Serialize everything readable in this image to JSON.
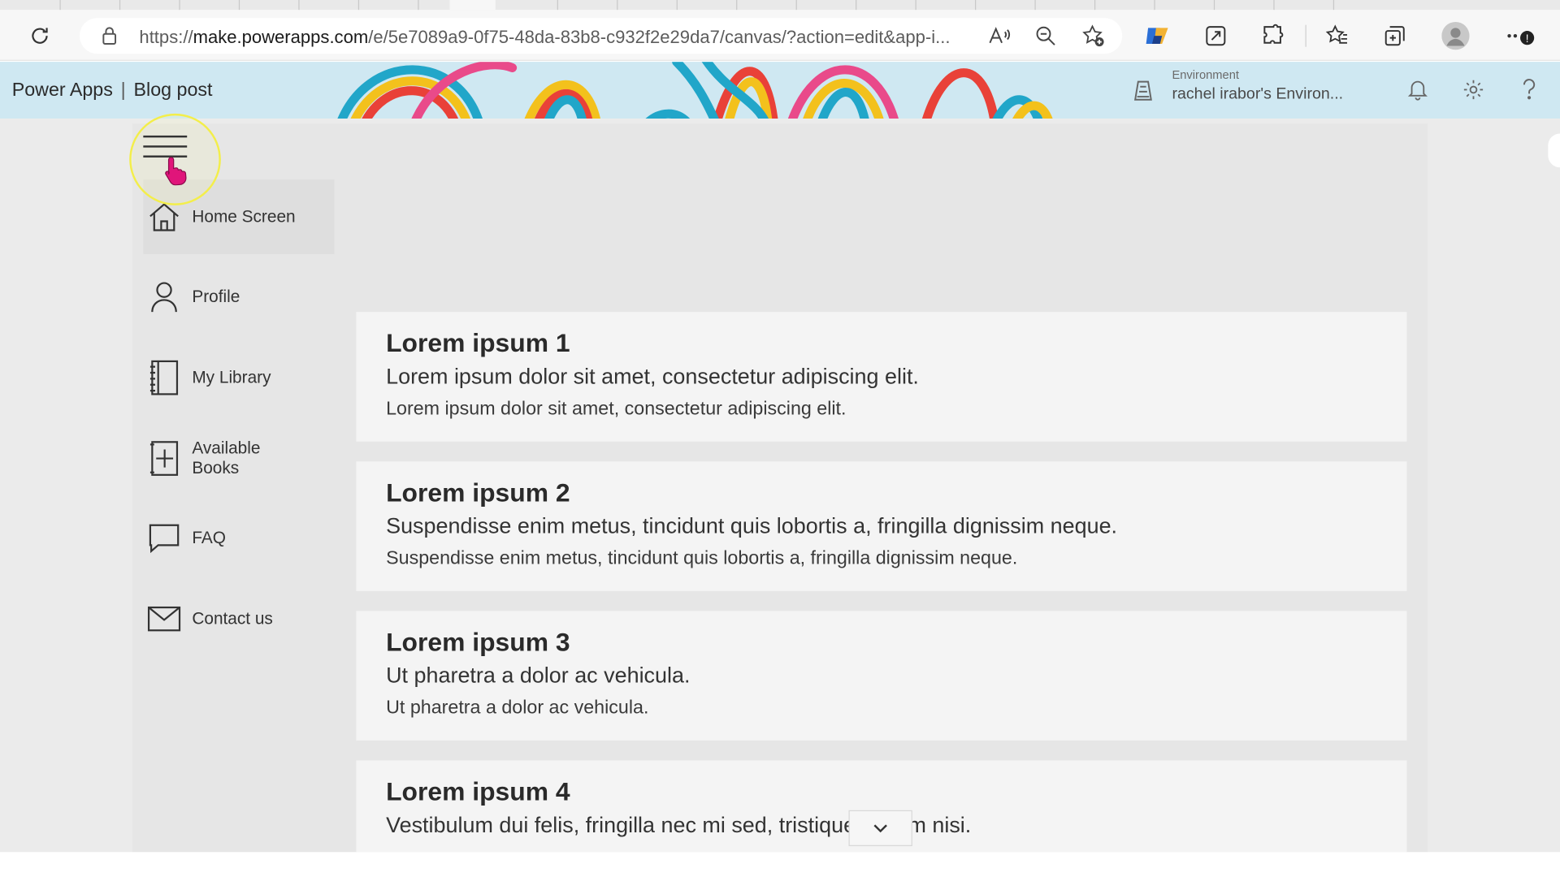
{
  "browser": {
    "url_prefix": "https://",
    "url_host": "make.powerapps.com",
    "url_path": "/e/5e7089a9-0f75-48da-83b8-c932f2e29da7/canvas/?action=edit&app-i...",
    "toolbar_icons": [
      "refresh-icon",
      "lock-icon",
      "read-aloud-icon",
      "zoom-out-icon",
      "add-favorite-icon",
      "copilot-icon",
      "share-icon",
      "extensions-icon",
      "favorites-icon",
      "collections-icon",
      "profile-icon",
      "more-icon"
    ]
  },
  "header": {
    "app": "Power Apps",
    "separator": "|",
    "app_name": "Blog post",
    "env_label": "Environment",
    "env_value": "rachel irabor's Environ..."
  },
  "nav": {
    "items": [
      {
        "label": "Home Screen",
        "icon": "home-icon"
      },
      {
        "label": "Profile",
        "icon": "person-icon"
      },
      {
        "label": "My Library",
        "icon": "notebook-icon"
      },
      {
        "label": "Available Books",
        "icon": "add-book-icon"
      },
      {
        "label": "FAQ",
        "icon": "chat-icon"
      },
      {
        "label": "Contact us",
        "icon": "mail-icon"
      }
    ]
  },
  "cards": [
    {
      "title": "Lorem ipsum 1",
      "line1": "Lorem ipsum dolor sit amet, consectetur adipiscing elit.",
      "line2": "Lorem ipsum dolor sit amet, consectetur adipiscing elit."
    },
    {
      "title": "Lorem ipsum 2",
      "line1": "Suspendisse enim metus, tincidunt quis lobortis a, fringilla dignissim neque.",
      "line2": "Suspendisse enim metus, tincidunt quis lobortis a, fringilla dignissim neque."
    },
    {
      "title": "Lorem ipsum 3",
      "line1": "Ut pharetra a dolor ac vehicula.",
      "line2": "Ut pharetra a dolor ac vehicula."
    },
    {
      "title": "Lorem ipsum 4",
      "line1": "Vestibulum dui felis, fringilla nec mi sed, tristique dictum nisi.",
      "line2": ""
    }
  ],
  "colors": {
    "header_bg": "#cfe8f2",
    "canvas_bg": "#ebebeb",
    "card_bg": "#f4f4f4",
    "click_ring": "#f3ee4a",
    "cursor": "#e0157a"
  }
}
